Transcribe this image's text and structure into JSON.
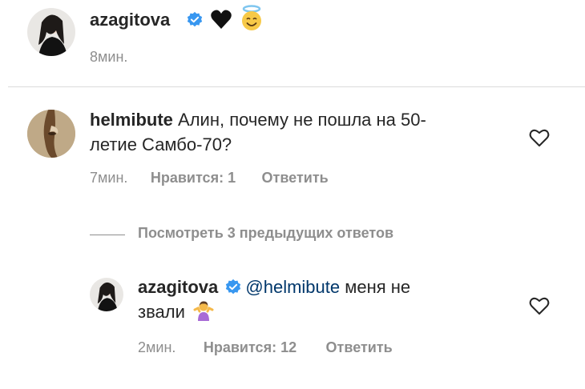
{
  "post": {
    "username": "azagitova",
    "caption_emoji": [
      "black-heart",
      "smiling-face-with-halo"
    ],
    "time": "8мин."
  },
  "comments": [
    {
      "username": "helmibute",
      "text_line1": "Алин, почему не пошла на 50-",
      "text_line2": "летие Самбо-70?",
      "time": "7мин.",
      "likes": "Нравится: 1",
      "reply": "Ответить"
    }
  ],
  "view_replies": "Посмотреть 3 предыдущих ответов",
  "reply": {
    "username": "azagitova",
    "mention": "@helmibute",
    "text_after_mention": " меня не",
    "text_line2": "звали",
    "emoji": "person-shrugging",
    "time": "2мин.",
    "likes": "Нравится: 12",
    "reply": "Ответить"
  },
  "colors": {
    "text": "#262626",
    "secondary": "#8e8e8e",
    "mention": "#00376b",
    "verified": "#3897f0"
  }
}
